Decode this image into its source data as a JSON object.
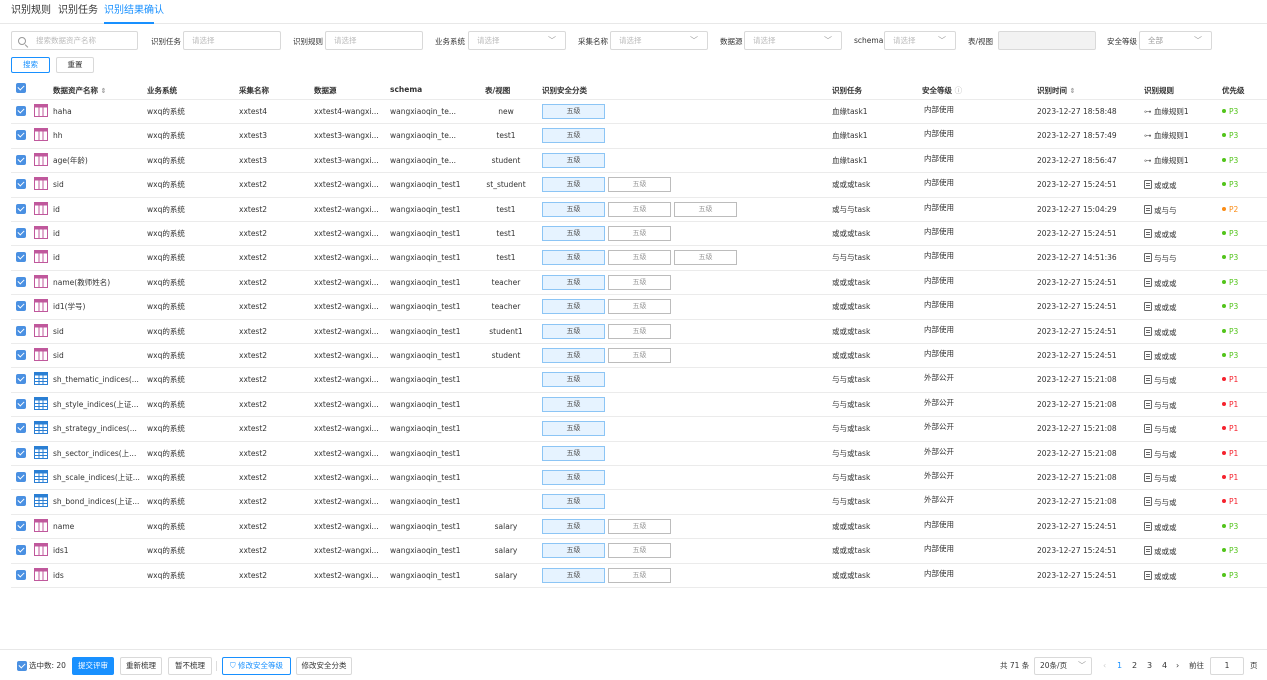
{
  "tabs": [
    {
      "label": "识别规则"
    },
    {
      "label": "识别任务"
    },
    {
      "label": "识别结果确认"
    }
  ],
  "filters": {
    "search_placeholder": "搜索数据资产名称",
    "task_label": "识别任务",
    "task_placeholder": "请选择",
    "rule_label": "识别规则",
    "rule_placeholder": "请选择",
    "system_label": "业务系统",
    "system_placeholder": "请选择",
    "collect_label": "采集名称",
    "collect_placeholder": "请选择",
    "source_label": "数据源",
    "source_placeholder": "请选择",
    "schema_label": "schema",
    "schema_placeholder": "请选择",
    "view_label": "表/视图",
    "view_value": "",
    "level_label": "安全等级",
    "level_value": "全部",
    "search_btn": "搜索",
    "reset_btn": "重置"
  },
  "columns": {
    "name": "数据资产名称",
    "system": "业务系统",
    "collect": "采集名称",
    "source": "数据源",
    "schema": "schema",
    "table": "表/视图",
    "category": "识别安全分类",
    "task": "识别任务",
    "level": "安全等级",
    "time": "识别时间",
    "rule": "识别规则",
    "priority": "优先级"
  },
  "colors": {
    "accent": "#1890ff",
    "p3": "#52c41a",
    "p2": "#fa8c16",
    "p1": "#f5222d",
    "icon_pink": "#c0589c",
    "icon_blue": "#2a7fd4"
  },
  "rows": [
    {
      "icon": "table-pink",
      "name": "haha",
      "system": "wxq的系统",
      "collect": "xxtest4",
      "source": "xxtest4-wangxi...",
      "schema": "wangxiaoqin_te...",
      "table": "new",
      "tags": [
        "五级"
      ],
      "task": "血缘task1",
      "level": "内部使用",
      "time": "2023-12-27 18:58:48",
      "rule_icon": "lineage",
      "rule": "血缘规则1",
      "priority": "P3"
    },
    {
      "icon": "table-pink",
      "name": "hh",
      "system": "wxq的系统",
      "collect": "xxtest3",
      "source": "xxtest3-wangxi...",
      "schema": "wangxiaoqin_te...",
      "table": "test1",
      "tags": [
        "五级"
      ],
      "task": "血缘task1",
      "level": "内部使用",
      "time": "2023-12-27 18:57:49",
      "rule_icon": "lineage",
      "rule": "血缘规则1",
      "priority": "P3"
    },
    {
      "icon": "table-pink",
      "name": "age(年龄)",
      "system": "wxq的系统",
      "collect": "xxtest3",
      "source": "xxtest3-wangxi...",
      "schema": "wangxiaoqin_te...",
      "table": "student",
      "tags": [
        "五级"
      ],
      "task": "血缘task1",
      "level": "内部使用",
      "time": "2023-12-27 18:56:47",
      "rule_icon": "lineage",
      "rule": "血缘规则1",
      "priority": "P3"
    },
    {
      "icon": "table-pink",
      "name": "sid",
      "system": "wxq的系统",
      "collect": "xxtest2",
      "source": "xxtest2-wangxi...",
      "schema": "wangxiaoqin_test1",
      "table": "st_student",
      "tags": [
        "五级",
        "五级"
      ],
      "task": "或或或task",
      "level": "内部使用",
      "time": "2023-12-27 15:24:51",
      "rule_icon": "doc",
      "rule": "或或或",
      "priority": "P3"
    },
    {
      "icon": "table-pink",
      "name": "id",
      "system": "wxq的系统",
      "collect": "xxtest2",
      "source": "xxtest2-wangxi...",
      "schema": "wangxiaoqin_test1",
      "table": "test1",
      "tags": [
        "五级",
        "五级",
        "五级"
      ],
      "task": "或与与task",
      "level": "内部使用",
      "time": "2023-12-27 15:04:29",
      "rule_icon": "doc",
      "rule": "或与与",
      "priority": "P2"
    },
    {
      "icon": "table-pink",
      "name": "id",
      "system": "wxq的系统",
      "collect": "xxtest2",
      "source": "xxtest2-wangxi...",
      "schema": "wangxiaoqin_test1",
      "table": "test1",
      "tags": [
        "五级",
        "五级"
      ],
      "task": "或或或task",
      "level": "内部使用",
      "time": "2023-12-27 15:24:51",
      "rule_icon": "doc",
      "rule": "或或或",
      "priority": "P3"
    },
    {
      "icon": "table-pink",
      "name": "id",
      "system": "wxq的系统",
      "collect": "xxtest2",
      "source": "xxtest2-wangxi...",
      "schema": "wangxiaoqin_test1",
      "table": "test1",
      "tags": [
        "五级",
        "五级",
        "五级"
      ],
      "task": "与与与task",
      "level": "内部使用",
      "time": "2023-12-27 14:51:36",
      "rule_icon": "doc",
      "rule": "与与与",
      "priority": "P3"
    },
    {
      "icon": "table-pink",
      "name": "name(教师姓名)",
      "system": "wxq的系统",
      "collect": "xxtest2",
      "source": "xxtest2-wangxi...",
      "schema": "wangxiaoqin_test1",
      "table": "teacher",
      "tags": [
        "五级",
        "五级"
      ],
      "task": "或或或task",
      "level": "内部使用",
      "time": "2023-12-27 15:24:51",
      "rule_icon": "doc",
      "rule": "或或或",
      "priority": "P3"
    },
    {
      "icon": "table-pink",
      "name": "id1(学号)",
      "system": "wxq的系统",
      "collect": "xxtest2",
      "source": "xxtest2-wangxi...",
      "schema": "wangxiaoqin_test1",
      "table": "teacher",
      "tags": [
        "五级",
        "五级"
      ],
      "task": "或或或task",
      "level": "内部使用",
      "time": "2023-12-27 15:24:51",
      "rule_icon": "doc",
      "rule": "或或或",
      "priority": "P3"
    },
    {
      "icon": "table-pink",
      "name": "sid",
      "system": "wxq的系统",
      "collect": "xxtest2",
      "source": "xxtest2-wangxi...",
      "schema": "wangxiaoqin_test1",
      "table": "student1",
      "tags": [
        "五级",
        "五级"
      ],
      "task": "或或或task",
      "level": "内部使用",
      "time": "2023-12-27 15:24:51",
      "rule_icon": "doc",
      "rule": "或或或",
      "priority": "P3"
    },
    {
      "icon": "table-pink",
      "name": "sid",
      "system": "wxq的系统",
      "collect": "xxtest2",
      "source": "xxtest2-wangxi...",
      "schema": "wangxiaoqin_test1",
      "table": "student",
      "tags": [
        "五级",
        "五级"
      ],
      "task": "或或或task",
      "level": "内部使用",
      "time": "2023-12-27 15:24:51",
      "rule_icon": "doc",
      "rule": "或或或",
      "priority": "P3"
    },
    {
      "icon": "table-blue",
      "name": "sh_thematic_indices(...",
      "system": "wxq的系统",
      "collect": "xxtest2",
      "source": "xxtest2-wangxi...",
      "schema": "wangxiaoqin_test1",
      "table": "",
      "tags": [
        "五级"
      ],
      "task": "与与或task",
      "level": "外部公开",
      "time": "2023-12-27 15:21:08",
      "rule_icon": "doc",
      "rule": "与与或",
      "priority": "P1"
    },
    {
      "icon": "table-blue",
      "name": "sh_style_indices(上证...",
      "system": "wxq的系统",
      "collect": "xxtest2",
      "source": "xxtest2-wangxi...",
      "schema": "wangxiaoqin_test1",
      "table": "",
      "tags": [
        "五级"
      ],
      "task": "与与或task",
      "level": "外部公开",
      "time": "2023-12-27 15:21:08",
      "rule_icon": "doc",
      "rule": "与与或",
      "priority": "P1"
    },
    {
      "icon": "table-blue",
      "name": "sh_strategy_indices(...",
      "system": "wxq的系统",
      "collect": "xxtest2",
      "source": "xxtest2-wangxi...",
      "schema": "wangxiaoqin_test1",
      "table": "",
      "tags": [
        "五级"
      ],
      "task": "与与或task",
      "level": "外部公开",
      "time": "2023-12-27 15:21:08",
      "rule_icon": "doc",
      "rule": "与与或",
      "priority": "P1"
    },
    {
      "icon": "table-blue",
      "name": "sh_sector_indices(上...",
      "system": "wxq的系统",
      "collect": "xxtest2",
      "source": "xxtest2-wangxi...",
      "schema": "wangxiaoqin_test1",
      "table": "",
      "tags": [
        "五级"
      ],
      "task": "与与或task",
      "level": "外部公开",
      "time": "2023-12-27 15:21:08",
      "rule_icon": "doc",
      "rule": "与与或",
      "priority": "P1"
    },
    {
      "icon": "table-blue",
      "name": "sh_scale_indices(上证...",
      "system": "wxq的系统",
      "collect": "xxtest2",
      "source": "xxtest2-wangxi...",
      "schema": "wangxiaoqin_test1",
      "table": "",
      "tags": [
        "五级"
      ],
      "task": "与与或task",
      "level": "外部公开",
      "time": "2023-12-27 15:21:08",
      "rule_icon": "doc",
      "rule": "与与或",
      "priority": "P1"
    },
    {
      "icon": "table-blue",
      "name": "sh_bond_indices(上证...",
      "system": "wxq的系统",
      "collect": "xxtest2",
      "source": "xxtest2-wangxi...",
      "schema": "wangxiaoqin_test1",
      "table": "",
      "tags": [
        "五级"
      ],
      "task": "与与或task",
      "level": "外部公开",
      "time": "2023-12-27 15:21:08",
      "rule_icon": "doc",
      "rule": "与与或",
      "priority": "P1"
    },
    {
      "icon": "table-pink",
      "name": "name",
      "system": "wxq的系统",
      "collect": "xxtest2",
      "source": "xxtest2-wangxi...",
      "schema": "wangxiaoqin_test1",
      "table": "salary",
      "tags": [
        "五级",
        "五级"
      ],
      "task": "或或或task",
      "level": "内部使用",
      "time": "2023-12-27 15:24:51",
      "rule_icon": "doc",
      "rule": "或或或",
      "priority": "P3"
    },
    {
      "icon": "table-pink",
      "name": "ids1",
      "system": "wxq的系统",
      "collect": "xxtest2",
      "source": "xxtest2-wangxi...",
      "schema": "wangxiaoqin_test1",
      "table": "salary",
      "tags": [
        "五级",
        "五级"
      ],
      "task": "或或或task",
      "level": "内部使用",
      "time": "2023-12-27 15:24:51",
      "rule_icon": "doc",
      "rule": "或或或",
      "priority": "P3"
    },
    {
      "icon": "table-pink",
      "name": "ids",
      "system": "wxq的系统",
      "collect": "xxtest2",
      "source": "xxtest2-wangxi...",
      "schema": "wangxiaoqin_test1",
      "table": "salary",
      "tags": [
        "五级",
        "五级"
      ],
      "task": "或或或task",
      "level": "内部使用",
      "time": "2023-12-27 15:24:51",
      "rule_icon": "doc",
      "rule": "或或或",
      "priority": "P3"
    }
  ],
  "footer": {
    "selected_label": "选中数: 20",
    "submit": "提交评审",
    "recomb": "重新梳理",
    "skip": "暂不梳理",
    "modify_level": "修改安全等级",
    "modify_cat": "修改安全分类",
    "total": "共 71 条",
    "page_size": "20条/页",
    "pages": [
      "1",
      "2",
      "3",
      "4"
    ],
    "current_page": "1",
    "goto_label": "前往",
    "goto_value": "1",
    "page_suffix": "页"
  }
}
